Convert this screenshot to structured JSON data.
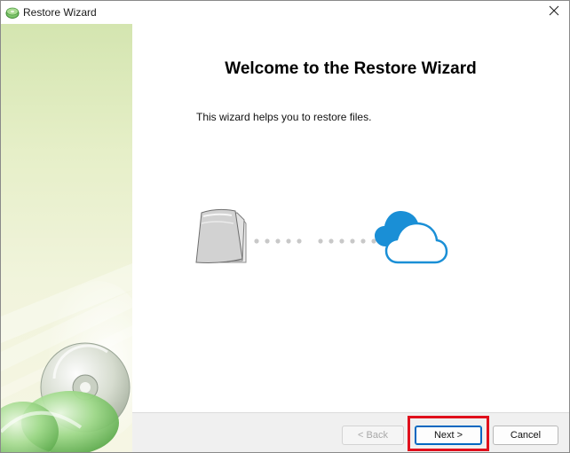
{
  "window": {
    "title": "Restore Wizard",
    "icon": "restore-disc-icon"
  },
  "titlebar": {
    "close_icon": "close-icon"
  },
  "content": {
    "heading": "Welcome to the Restore Wizard",
    "description": "This wizard helps you to restore files.",
    "illustration": {
      "source_icon": "files-stack-icon",
      "target_icon": "cloud-icon",
      "connector": "dotted-line"
    }
  },
  "footer": {
    "back_label": "< Back",
    "next_label": "Next >",
    "cancel_label": "Cancel",
    "back_enabled": false
  },
  "colors": {
    "accent": "#0067c0",
    "cloud": "#1a8fd6",
    "highlight": "#e0101c",
    "sidebar_green": "#d4e5b0"
  }
}
